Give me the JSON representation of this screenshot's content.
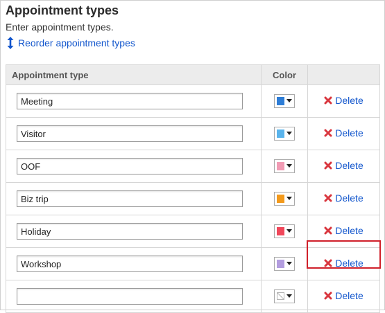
{
  "header": {
    "title": "Appointment types",
    "description": "Enter appointment types.",
    "reorder_label": "Reorder appointment types"
  },
  "table": {
    "columns": [
      "Appointment type",
      "Color",
      ""
    ],
    "delete_label": "Delete",
    "rows": [
      {
        "value": "Meeting",
        "color": "#2e7dd6"
      },
      {
        "value": "Visitor",
        "color": "#5ab4ec"
      },
      {
        "value": "OOF",
        "color": "#f19bb4"
      },
      {
        "value": "Biz trip",
        "color": "#f39a1c"
      },
      {
        "value": "Holiday",
        "color": "#f0475a"
      },
      {
        "value": "Workshop",
        "color": "#b39ddf"
      },
      {
        "value": "",
        "color": null
      }
    ],
    "highlighted_row": 5
  },
  "icons": {
    "reorder": "up-down-arrow-icon",
    "delete": "red-x-icon",
    "dropdown": "caret-down-icon"
  },
  "colors": {
    "link": "#1155cc",
    "delete_icon": "#d9363e",
    "highlight_border": "#d0202a",
    "header_bg": "#ececec"
  }
}
